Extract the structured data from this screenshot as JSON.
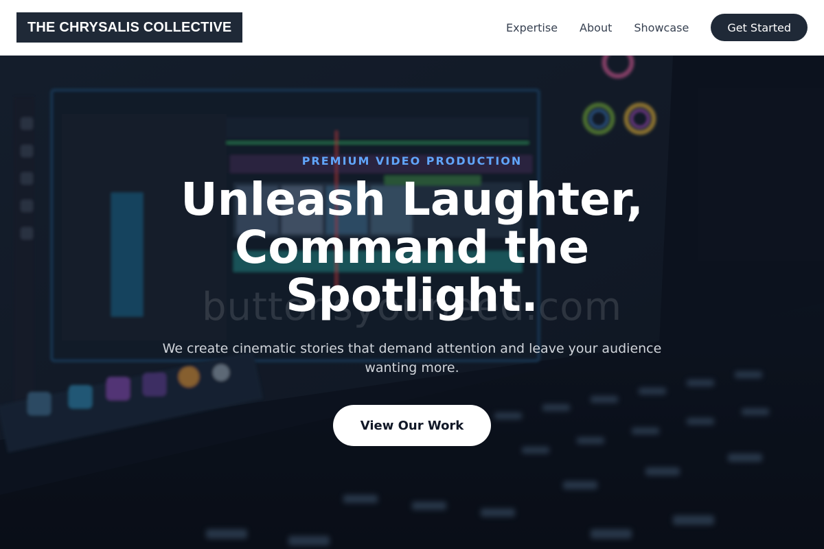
{
  "header": {
    "logo": "THE CHRYSALIS COLLECTIVE",
    "nav": [
      {
        "label": "Expertise"
      },
      {
        "label": "About"
      },
      {
        "label": "Showcase"
      }
    ],
    "cta_label": "Get Started"
  },
  "hero": {
    "eyebrow": "PREMIUM VIDEO PRODUCTION",
    "headline": "Unleash Laughter, Command the Spotlight.",
    "subhead": "We create cinematic stories that demand attention and leave your audience wanting more.",
    "cta_label": "View Our Work",
    "watermark": "buttonsyouneed.com",
    "background_image": "video-editing-screen-with-keyboard"
  },
  "colors": {
    "brand_dark": "#1f2937",
    "accent": "#60a5fa",
    "white": "#ffffff"
  }
}
